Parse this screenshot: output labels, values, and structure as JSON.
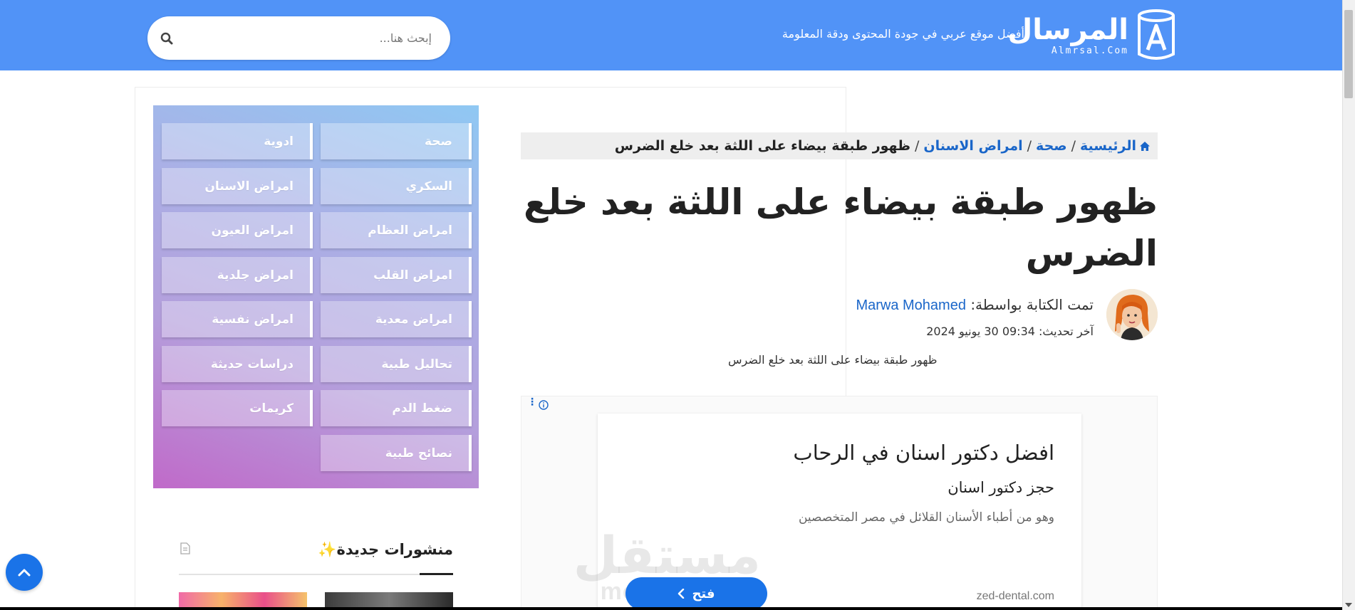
{
  "header": {
    "logo_name": "المرسال",
    "logo_sub": "Almrsal.Com",
    "tagline": "أفضل موقع عربي في جودة المحتوى ودقة المعلومة",
    "search_placeholder": "إبحث هنا...",
    "background": "#5193f7"
  },
  "breadcrumb": {
    "home": "الرئيسية",
    "items": [
      "صحة",
      "امراض الاسنان"
    ],
    "separator": "/",
    "current": "ظهور طبقة بيضاء على اللثة بعد خلع الضرس"
  },
  "article": {
    "title": "ظهور طبقة بيضاء على اللثة بعد خلع الضرس",
    "byline_prefix": "تمت الكتابة بواسطة:",
    "author": "Marwa Mohamed",
    "updated": "آخر تحديث: 09:34 30 يونيو 2024",
    "excerpt": "ظهور طبقة بيضاء على اللثة بعد خلع الضرس"
  },
  "ad": {
    "title": "افضل دكتور اسنان في الرحاب",
    "subtitle": "حجز دكتور اسنان",
    "description": "وهو من أطباء الأسنان القلائل في مصر المتخصصين",
    "domain": "zed-dental.com",
    "open_label": "فتح"
  },
  "watermark": {
    "ar": "مستقل",
    "en": "mostaql.com"
  },
  "sidebar": {
    "categories": [
      "صحة",
      "ادوية",
      "السكري",
      "امراض الاسنان",
      "امراض العظام",
      "امراض العيون",
      "امراض القلب",
      "امراض جلدية",
      "امراض معدية",
      "امراض نفسية",
      "تحاليل طبية",
      "دراسات حديثة",
      "ضغط الدم",
      "كريمات",
      "نصائح طبية"
    ],
    "new_posts_title": "منشورات جديدة",
    "new_posts_emoji": "✨"
  },
  "colors": {
    "link": "#1a66c9",
    "accent_button": "#1a73e8"
  }
}
